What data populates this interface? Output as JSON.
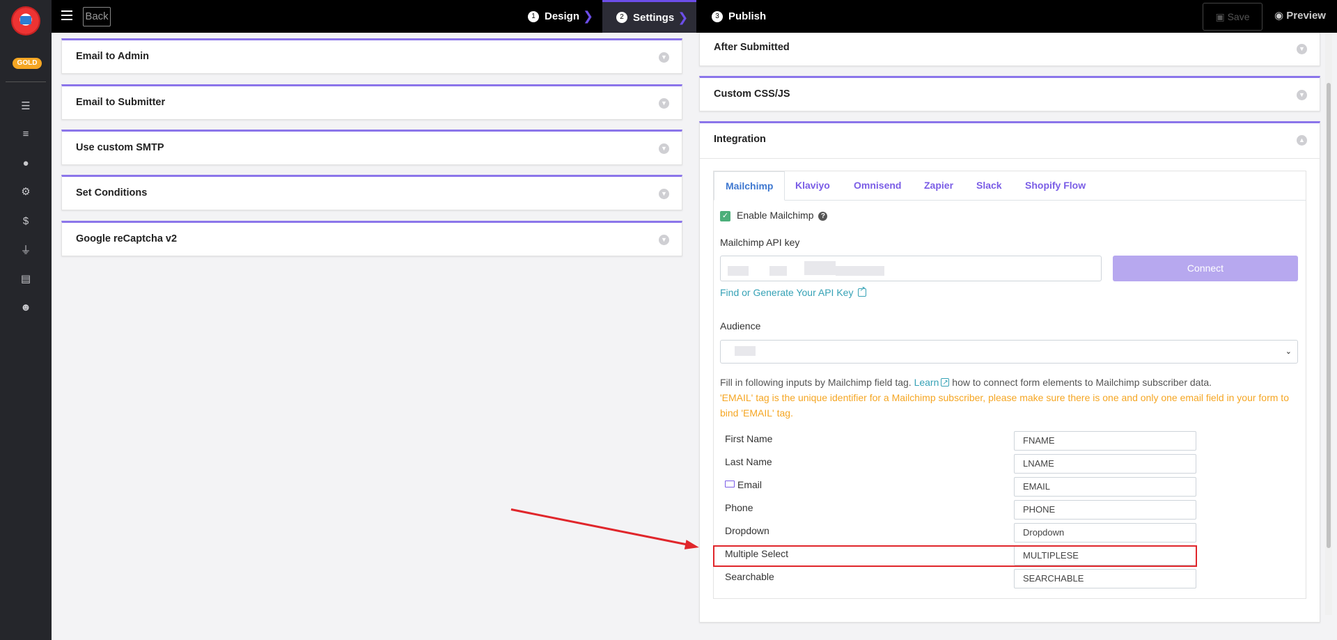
{
  "sidebar": {
    "badge": "GOLD",
    "icons": [
      "list-icon",
      "checklist-icon",
      "user-icon",
      "gear-icon",
      "dollar-icon",
      "plug-icon",
      "file-icon",
      "smile-icon"
    ]
  },
  "topbar": {
    "back_label": "Back",
    "steps": [
      {
        "num": "1",
        "label": "Design"
      },
      {
        "num": "2",
        "label": "Settings"
      },
      {
        "num": "3",
        "label": "Publish"
      }
    ],
    "save_label": "Save",
    "preview_label": "Preview"
  },
  "left_panels": [
    "Email to Admin",
    "Email to Submitter",
    "Use custom SMTP",
    "Set Conditions",
    "Google reCaptcha v2"
  ],
  "right_panels": {
    "after_submitted": "After Submitted",
    "custom_css": "Custom CSS/JS",
    "integration": "Integration"
  },
  "integration": {
    "tabs": [
      "Mailchimp",
      "Klaviyo",
      "Omnisend",
      "Zapier",
      "Slack",
      "Shopify Flow"
    ],
    "enable_label": "Enable Mailchimp",
    "api_key_label": "Mailchimp API key",
    "connect_label": "Connect",
    "find_key_link": "Find or Generate Your API Key",
    "audience_label": "Audience",
    "info_prefix": "Fill in following inputs by Mailchimp field tag.",
    "info_link": "Learn",
    "info_suffix": "how to connect form elements to Mailchimp subscriber data.",
    "warning": "'EMAIL' tag is the unique identifier for a Mailchimp subscriber, please make sure there is one and only one email field in your form to bind 'EMAIL' tag.",
    "fields": [
      {
        "label": "First Name",
        "tag": "FNAME"
      },
      {
        "label": "Last Name",
        "tag": "LNAME"
      },
      {
        "label": "Email",
        "tag": "EMAIL"
      },
      {
        "label": "Phone",
        "tag": "PHONE"
      },
      {
        "label": "Dropdown",
        "tag": "Dropdown"
      },
      {
        "label": "Multiple Select",
        "tag": "MULTIPLESE"
      },
      {
        "label": "Searchable",
        "tag": "SEARCHABLE"
      }
    ]
  },
  "colors": {
    "accent": "#8b75ea",
    "tab_active": "#3f78d0",
    "link": "#36a2b6",
    "warning": "#f5a623",
    "highlight": "#e0262b"
  }
}
